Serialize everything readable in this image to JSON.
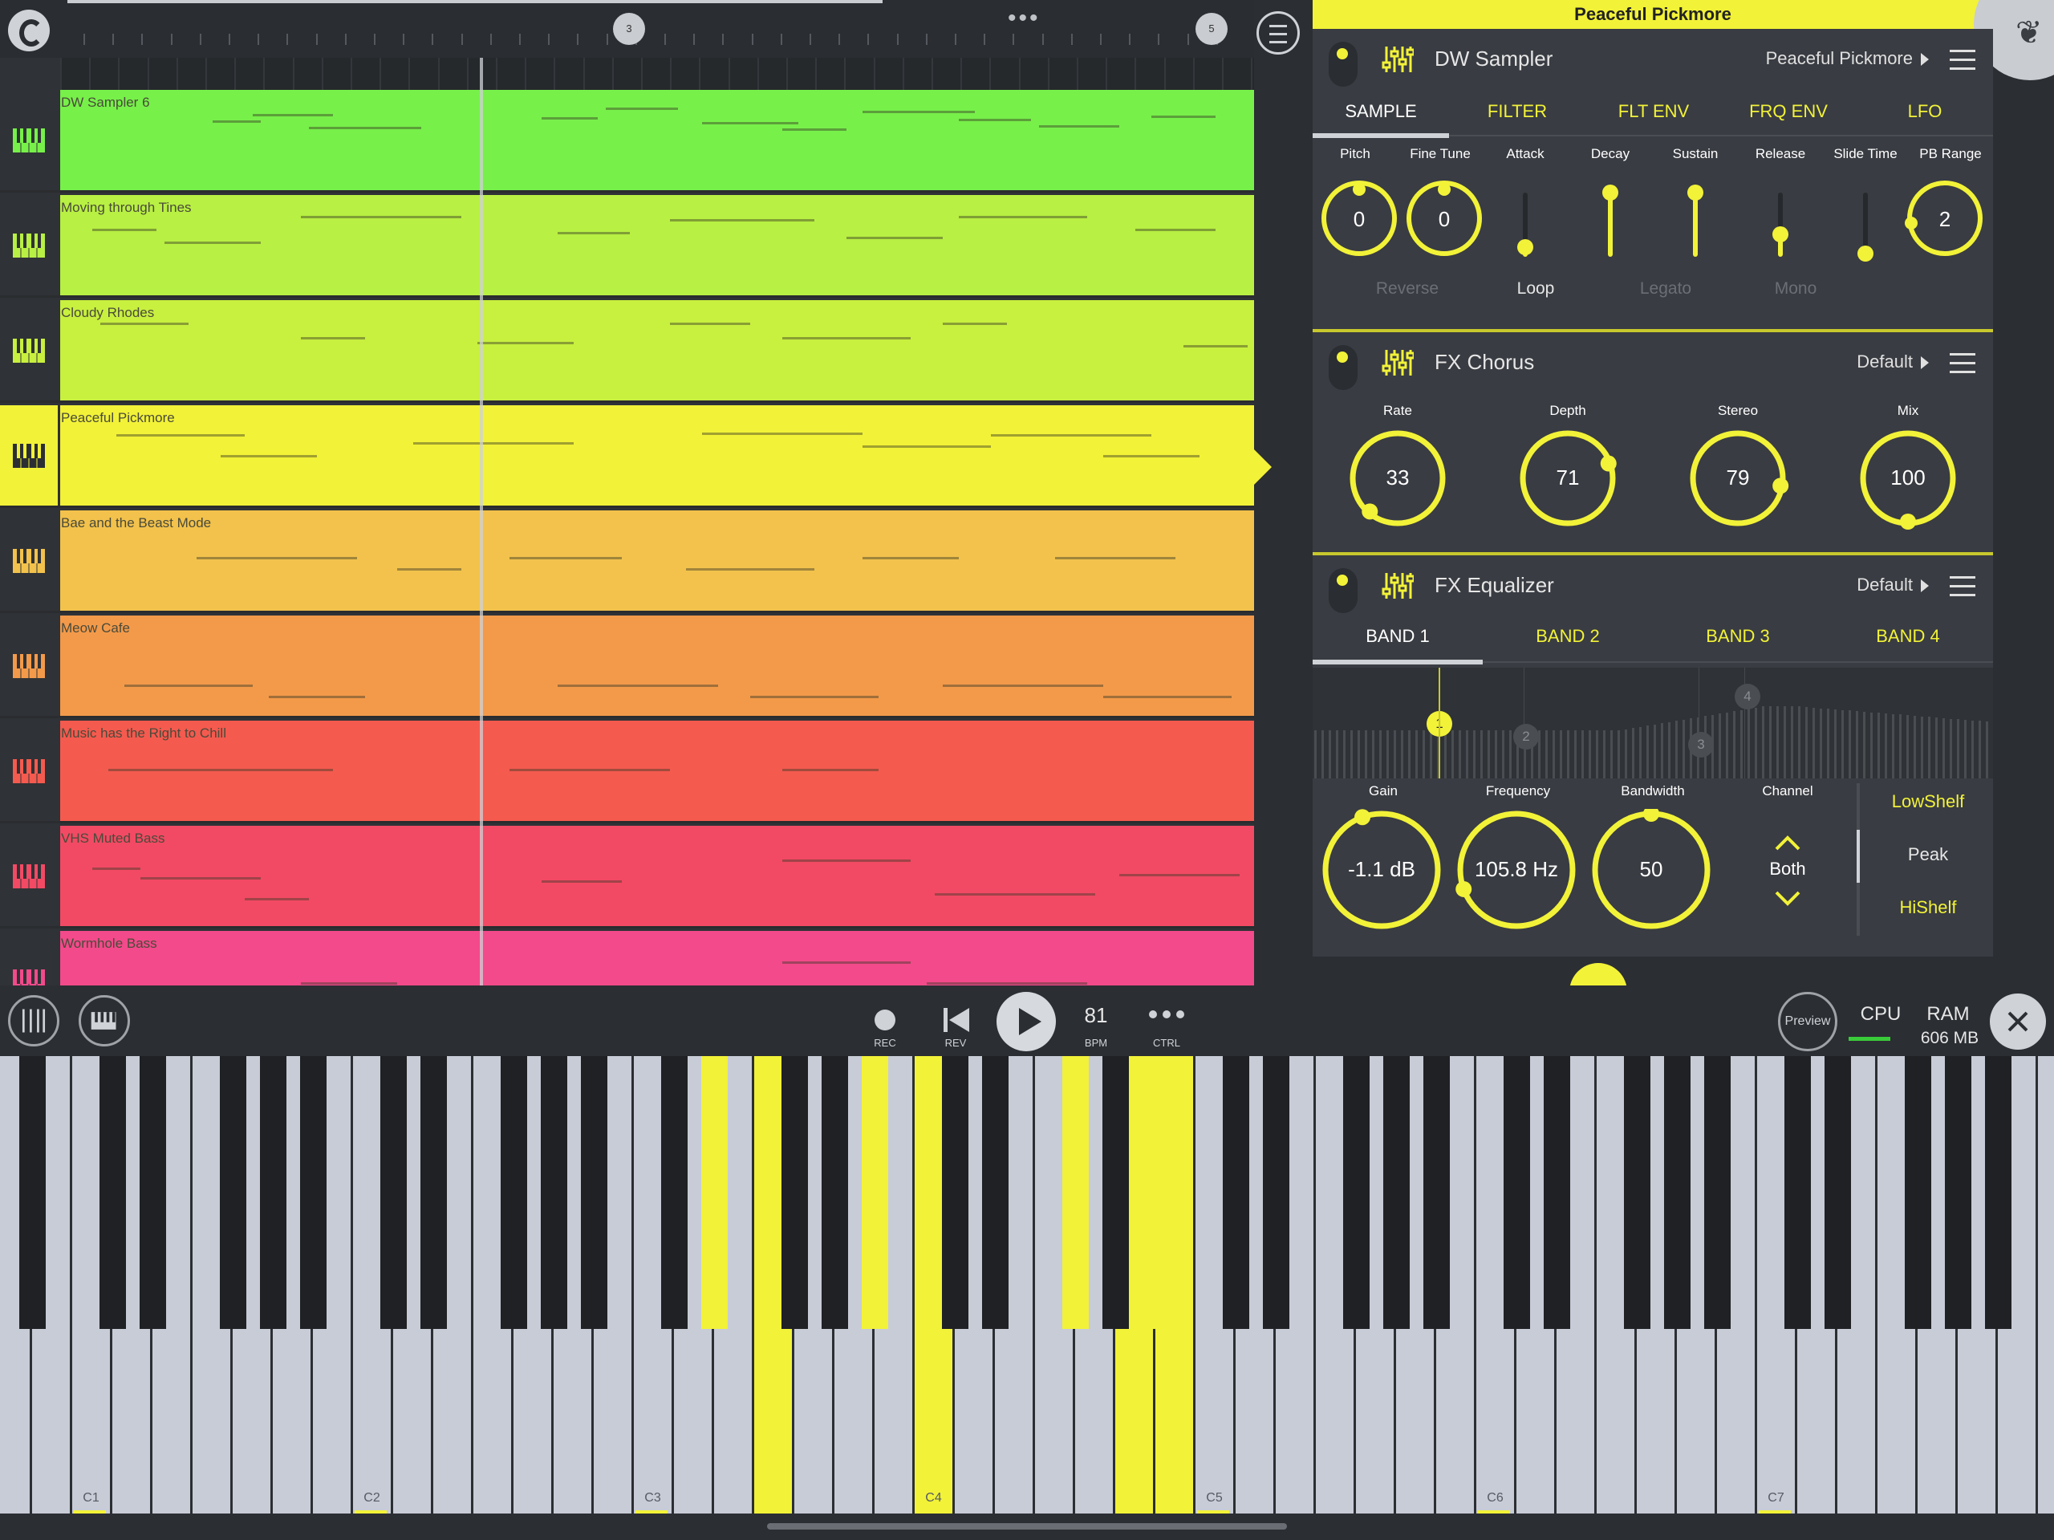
{
  "timeline": {
    "markers": [
      "3",
      "5"
    ],
    "more_label": "•••"
  },
  "tracks": [
    {
      "name": "DW Sampler 6",
      "color": "#77f04a"
    },
    {
      "name": "Moving through Tines",
      "color": "#b8f043"
    },
    {
      "name": "Cloudy Rhodes",
      "color": "#c8f03f"
    },
    {
      "name": "Peaceful Pickmore",
      "color": "#f2f238",
      "selected": true
    },
    {
      "name": "Bae and the Beast Mode",
      "color": "#f2c24c"
    },
    {
      "name": "Meow Cafe",
      "color": "#f39a4a"
    },
    {
      "name": "Music has the Right to Chill",
      "color": "#f55a4f"
    },
    {
      "name": "VHS Muted Bass",
      "color": "#f24a64"
    },
    {
      "name": "Wormhole Bass",
      "color": "#f24a8a"
    }
  ],
  "panel": {
    "title": "Peaceful Pickmore",
    "sampler": {
      "name": "DW Sampler",
      "preset": "Peaceful Pickmore",
      "tabs": [
        "SAMPLE",
        "FILTER",
        "FLT ENV",
        "FRQ ENV",
        "LFO"
      ],
      "active_tab": "SAMPLE",
      "labels": [
        "Pitch",
        "Fine Tune",
        "Attack",
        "Decay",
        "Sustain",
        "Release",
        "Slide Time",
        "PB Range"
      ],
      "pitch": "0",
      "fine_tune": "0",
      "pb_range": "2",
      "attack": 0.15,
      "decay": 1.0,
      "sustain": 1.0,
      "release": 0.35,
      "slide_time": 0.05,
      "toggles": [
        {
          "label": "Reverse",
          "on": false
        },
        {
          "label": "Loop",
          "on": true
        },
        {
          "label": "Legato",
          "on": false
        },
        {
          "label": "Mono",
          "on": false
        }
      ]
    },
    "chorus": {
      "name": "FX Chorus",
      "preset": "Default",
      "labels": [
        "Rate",
        "Depth",
        "Stereo",
        "Mix"
      ],
      "values": [
        "33",
        "71",
        "79",
        "100"
      ]
    },
    "equalizer": {
      "name": "FX Equalizer",
      "preset": "Default",
      "tabs": [
        "BAND 1",
        "BAND 2",
        "BAND 3",
        "BAND 4"
      ],
      "active_tab": "BAND 1",
      "nodes": [
        "1",
        "2",
        "3",
        "4"
      ],
      "labels": [
        "Gain",
        "Frequency",
        "Bandwidth",
        "Channel"
      ],
      "gain": "-1.1 dB",
      "frequency": "105.8 Hz",
      "bandwidth": "50",
      "channel": "Both",
      "shapes": [
        "LowShelf",
        "Peak",
        "HiShelf"
      ],
      "active_shape": "Peak"
    }
  },
  "transport": {
    "rec_label": "REC",
    "rev_label": "REV",
    "bpm": "81",
    "bpm_label": "BPM",
    "ctrl_label": "CTRL",
    "preview_label": "Preview",
    "cpu_label": "CPU",
    "ram_label": "RAM",
    "ram_value": "606 MB"
  },
  "keyboard": {
    "octave_labels": [
      "C1",
      "C2",
      "C3",
      "C4",
      "C5",
      "C6",
      "C7"
    ]
  },
  "colors": {
    "accent": "#f2f238",
    "background": "#2b2e33",
    "panel": "#393c42"
  }
}
